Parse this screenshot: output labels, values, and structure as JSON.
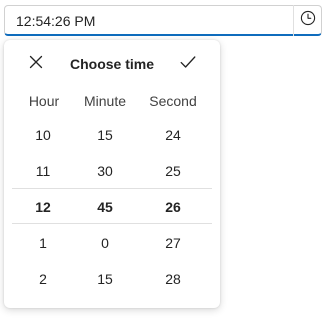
{
  "time_input": {
    "value": "12:54:26 PM",
    "clock_icon": "clock-icon"
  },
  "picker": {
    "title": "Choose time",
    "close_icon": "close-icon",
    "confirm_icon": "checkmark-icon",
    "headers": {
      "hour": "Hour",
      "minute": "Minute",
      "second": "Second"
    },
    "rows": [
      {
        "hour": "10",
        "minute": "15",
        "second": "24"
      },
      {
        "hour": "11",
        "minute": "30",
        "second": "25"
      },
      {
        "hour": "12",
        "minute": "45",
        "second": "26"
      },
      {
        "hour": "1",
        "minute": "0",
        "second": "27"
      },
      {
        "hour": "2",
        "minute": "15",
        "second": "28"
      }
    ]
  },
  "colors": {
    "accent": "#0f6cbd",
    "text": "#242424",
    "divider": "#e0e0e0"
  }
}
